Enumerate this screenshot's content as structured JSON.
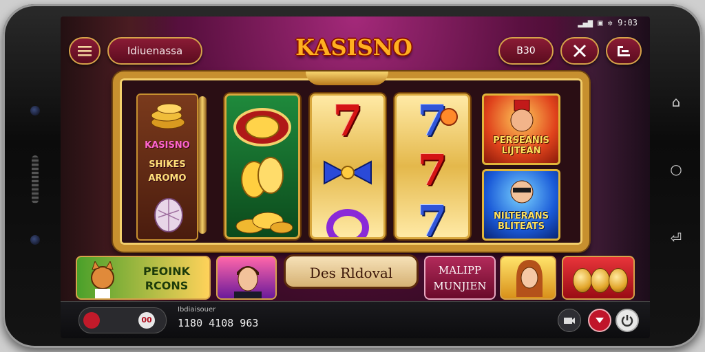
{
  "status_bar": {
    "time": "9:03"
  },
  "header": {
    "username": "Idiuenassa",
    "logo": "KASISNO",
    "coins": "B30"
  },
  "left_panel": {
    "line1": "KASISNO",
    "line2": "SHIKES\nAROMO"
  },
  "right_cards": [
    {
      "title": "PERSEANIS\nLIJTEAN"
    },
    {
      "title": "NILTERANS\nBLITEATS"
    }
  ],
  "bottom_tiles": {
    "tile1": "PEOINK\nRCONS",
    "tile3": "Des Rldoval",
    "tile4": "MALIPP\nMUNJIEN"
  },
  "bottom_bar": {
    "label": "Ibdiaisouer",
    "number": "1180 4108 963"
  },
  "colors": {
    "accent_gold": "#d6a34a",
    "brand_red": "#8a1b35",
    "logo_orange": "#ffb020"
  },
  "icons": [
    "menu-icon",
    "tools-icon",
    "exit-icon",
    "camera-icon",
    "chevron-down-icon",
    "power-icon",
    "back-icon",
    "home-icon",
    "recents-icon"
  ]
}
